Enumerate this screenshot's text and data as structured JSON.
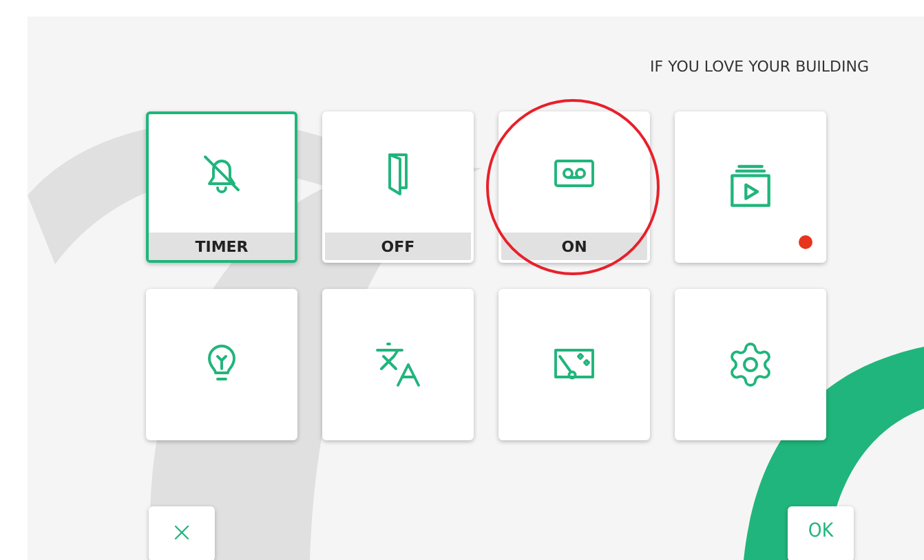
{
  "header": {
    "text": "IF YOU LOVE YOUR BUILDING"
  },
  "tiles": [
    {
      "kind": "bell-off",
      "label": "TIMER",
      "selected": true,
      "alert": false,
      "circled": false
    },
    {
      "kind": "door",
      "label": "OFF",
      "selected": false,
      "alert": false,
      "circled": false
    },
    {
      "kind": "voicemail",
      "label": "ON",
      "selected": false,
      "alert": false,
      "circled": true
    },
    {
      "kind": "video-stack",
      "selected": false,
      "alert": true,
      "circled": false
    },
    {
      "kind": "bulb",
      "selected": false,
      "alert": false,
      "circled": false
    },
    {
      "kind": "translate",
      "selected": false,
      "alert": false,
      "circled": false
    },
    {
      "kind": "magic-board",
      "selected": false,
      "alert": false,
      "circled": false
    },
    {
      "kind": "gear",
      "selected": false,
      "alert": false,
      "circled": false
    }
  ],
  "buttons": [
    {
      "kind": "cancel"
    },
    {
      "kind": "confirm",
      "label": "OK"
    }
  ]
}
